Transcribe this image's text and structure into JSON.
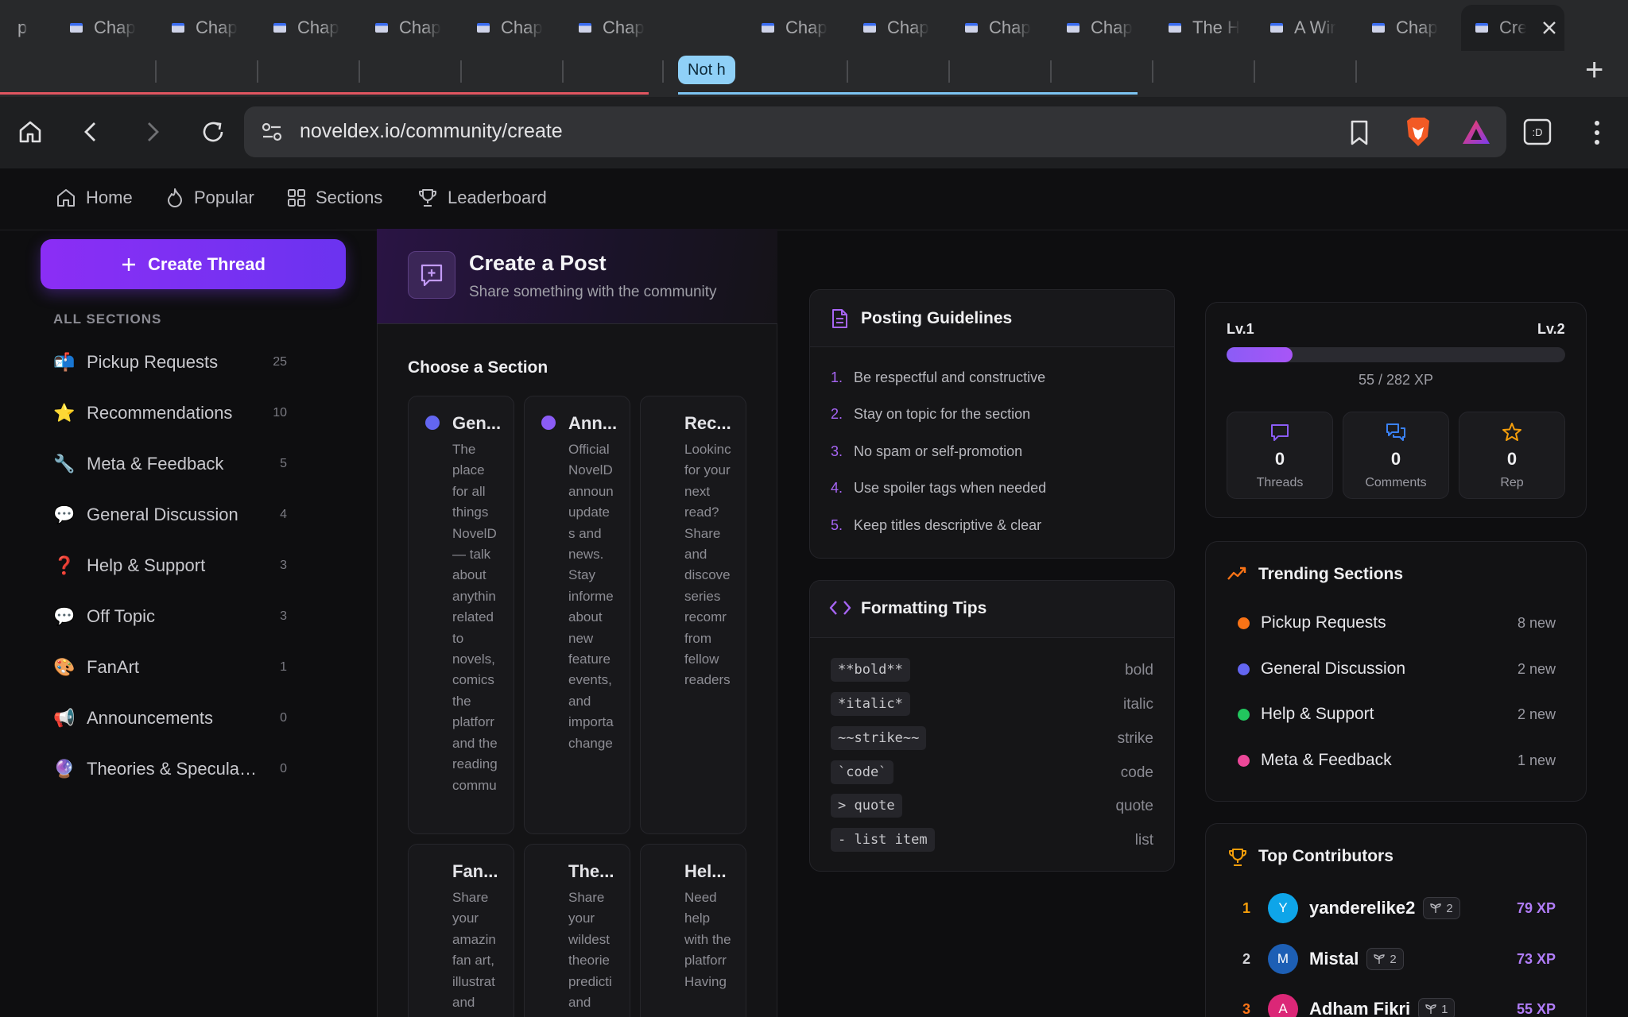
{
  "browser": {
    "tabs": [
      {
        "title": "Chap"
      },
      {
        "title": "Chap"
      },
      {
        "title": "Chap"
      },
      {
        "title": "Chap"
      },
      {
        "title": "Chap"
      },
      {
        "title": "Chap"
      },
      {
        "title": "Chap"
      },
      {
        "title": "Chap"
      },
      {
        "title": "Chap"
      },
      {
        "title": "Chap"
      },
      {
        "title": "The H"
      },
      {
        "title": "A Wir"
      },
      {
        "title": "Chap"
      },
      {
        "title": "Cre"
      }
    ],
    "tab_group_label": "Not h",
    "partial_first_tab": "p",
    "new_tab_symbol": "+",
    "url": "noveldex.io/community/create",
    "colors": {
      "group_pill": "#8fd0f7",
      "group_line_red": "#e05560",
      "group_line_blue": "#7cc4f2"
    }
  },
  "nav": {
    "items": [
      {
        "label": "Home",
        "icon": "home-icon"
      },
      {
        "label": "Popular",
        "icon": "flame-icon"
      },
      {
        "label": "Sections",
        "icon": "grid-icon"
      },
      {
        "label": "Leaderboard",
        "icon": "trophy-icon"
      }
    ]
  },
  "sidebar": {
    "create_label": "Create Thread",
    "section_title": "ALL SECTIONS",
    "items": [
      {
        "emoji": "📬",
        "label": "Pickup Requests",
        "count": "25"
      },
      {
        "emoji": "⭐",
        "label": "Recommendations",
        "count": "10"
      },
      {
        "emoji": "🔧",
        "label": "Meta & Feedback",
        "count": "5"
      },
      {
        "emoji": "💬",
        "label": "General Discussion",
        "count": "4"
      },
      {
        "emoji": "❓",
        "label": "Help & Support",
        "count": "3"
      },
      {
        "emoji": "💬",
        "label": "Off Topic",
        "count": "3"
      },
      {
        "emoji": "🎨",
        "label": "FanArt",
        "count": "1"
      },
      {
        "emoji": "📢",
        "label": "Announcements",
        "count": "0"
      },
      {
        "emoji": "🔮",
        "label": "Theories & Speculati...",
        "count": "0"
      }
    ]
  },
  "post": {
    "title": "Create a Post",
    "subtitle": "Share something with the community",
    "choose_label": "Choose a Section",
    "sections": [
      {
        "name": "Gen...",
        "color": "#6366f1",
        "desc": "The place for all things NovelD — talk about anythin related to novels, comics the platforr and the reading commu"
      },
      {
        "name": "Ann...",
        "color": "#f59e0b",
        "desc": "Official NovelD announ updates and news. Stay informe about new feature events, and importa change"
      },
      {
        "name": "Rec...",
        "color": "#22c55e",
        "desc": "Lookinc for your next read? Share and discove series recomr from fellow readers"
      },
      {
        "name": "Fan...",
        "color": "#8b5cf6",
        "desc": "Share your amazin fan art, illustrat and"
      },
      {
        "name": "The...",
        "color": "#a855f7",
        "desc": "Share your wildest theorie predicti and"
      },
      {
        "name": "Hel...",
        "color": "#22c55e",
        "desc": "Need help with the platforr Having"
      }
    ]
  },
  "guidelines": {
    "title": "Posting Guidelines",
    "items": [
      {
        "n": "1.",
        "text": "Be respectful and constructive"
      },
      {
        "n": "2.",
        "text": "Stay on topic for the section"
      },
      {
        "n": "3.",
        "text": "No spam or self-promotion"
      },
      {
        "n": "4.",
        "text": "Use spoiler tags when needed"
      },
      {
        "n": "5.",
        "text": "Keep titles descriptive & clear"
      }
    ]
  },
  "formatting": {
    "title": "Formatting Tips",
    "items": [
      {
        "code": "**bold**",
        "label": "bold"
      },
      {
        "code": "*italic*",
        "label": "italic"
      },
      {
        "code": "~~strike~~",
        "label": "strike"
      },
      {
        "code": "`code`",
        "label": "code"
      },
      {
        "code": "> quote",
        "label": "quote"
      },
      {
        "code": "- list item",
        "label": "list"
      }
    ]
  },
  "profile": {
    "level_from": "Lv.1",
    "level_to": "Lv.2",
    "xp_current": 55,
    "xp_total": 282,
    "xp_text": "55 / 282 XP",
    "stats": [
      {
        "value": "0",
        "label": "Threads",
        "icon": "chat-bubble-icon",
        "color": "#8b5cf6"
      },
      {
        "value": "0",
        "label": "Comments",
        "icon": "comments-icon",
        "color": "#3b82f6"
      },
      {
        "value": "0",
        "label": "Rep",
        "icon": "star-icon",
        "color": "#f59e0b"
      }
    ]
  },
  "trending": {
    "title": "Trending Sections",
    "items": [
      {
        "name": "Pickup Requests",
        "count": "8 new",
        "color": "#f97316"
      },
      {
        "name": "General Discussion",
        "count": "2 new",
        "color": "#6366f1"
      },
      {
        "name": "Help & Support",
        "count": "2 new",
        "color": "#22c55e"
      },
      {
        "name": "Meta & Feedback",
        "count": "1 new",
        "color": "#ec4899"
      }
    ]
  },
  "contributors": {
    "title": "Top Contributors",
    "items": [
      {
        "rank": "1",
        "initial": "Y",
        "name": "yanderelike2",
        "badge": "2",
        "xp": "79 XP",
        "rank_color": "#f59e0b",
        "avatar_color": "#0ea5e9"
      },
      {
        "rank": "2",
        "initial": "M",
        "name": "Mistal",
        "badge": "2",
        "xp": "73 XP",
        "rank_color": "#d4d4d8",
        "avatar_color": "#1d5fb5"
      },
      {
        "rank": "3",
        "initial": "A",
        "name": "Adham Fikri",
        "badge": "1",
        "xp": "55 XP",
        "rank_color": "#f97316",
        "avatar_color": "#db2777"
      }
    ]
  }
}
